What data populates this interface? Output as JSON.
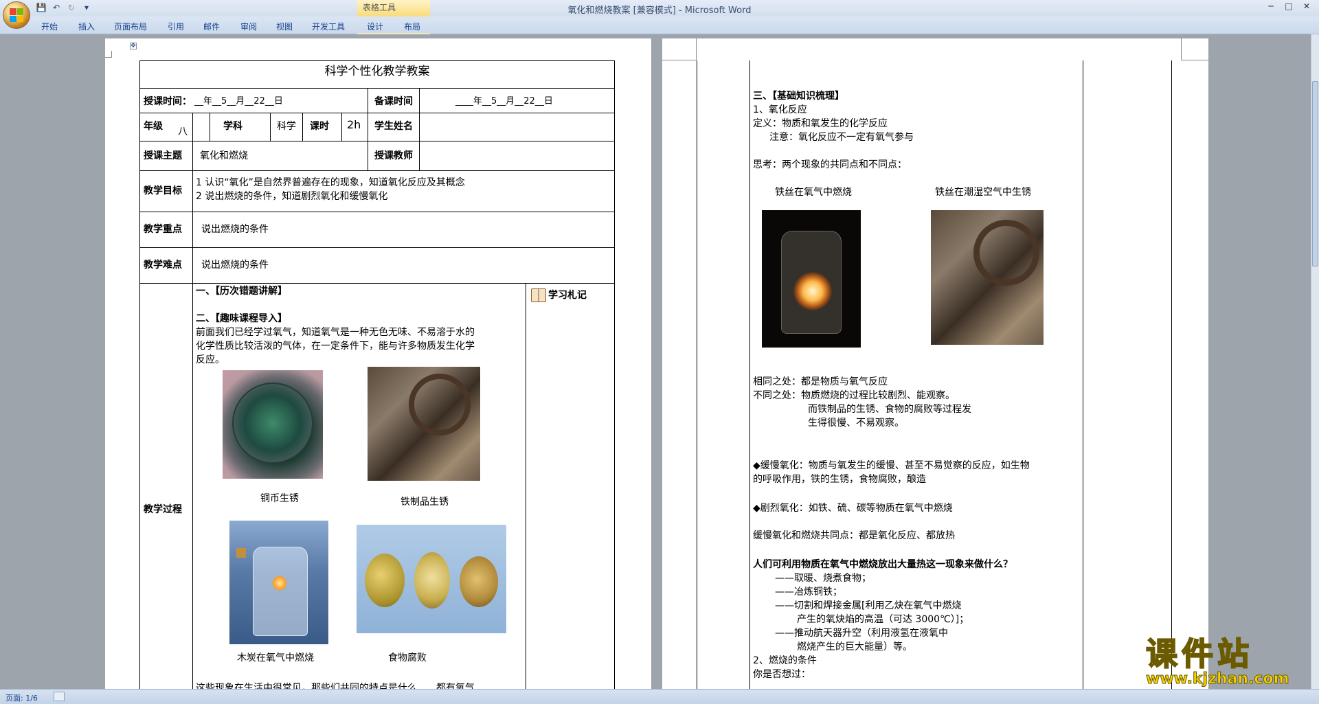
{
  "window": {
    "title": "氧化和燃烧教案 [兼容模式] - Microsoft Word",
    "context_tab": "表格工具"
  },
  "ribbon_tabs": [
    "开始",
    "插入",
    "页面布局",
    "引用",
    "邮件",
    "审阅",
    "视图",
    "开发工具",
    "设计",
    "布局"
  ],
  "status": {
    "page": "页面: 1/6"
  },
  "page1": {
    "title": "科学个性化教学教案",
    "row_time": {
      "label": "授课时间：",
      "value": "__年__5__月__22__日",
      "prep_label": "备课时间",
      "prep_value": "____年__5__月__22__日"
    },
    "row_grade": {
      "grade_label": "年级",
      "grade_value": "八",
      "subject_label": "学科",
      "subject_value": "科学",
      "hours_label": "课时",
      "hours_value": "2h",
      "student_label": "学生姓名"
    },
    "row_topic": {
      "label": "授课主题",
      "value": "氧化和燃烧",
      "teacher_label": "授课教师"
    },
    "row_goal": {
      "label": "教学目标",
      "lines": [
        "1 认识“氧化”是自然界普遍存在的现象，知道氧化反应及其概念",
        "2 说出燃烧的条件，知道剧烈氧化和缓慢氧化"
      ]
    },
    "row_key": {
      "label": "教学重点",
      "value": "说出燃烧的条件"
    },
    "row_diff": {
      "label": "教学难点",
      "value": "说出燃烧的条件"
    },
    "row_process": {
      "label": "教学过程",
      "notes_label": "学习札记",
      "h1": "一、【历次错题讲解】",
      "h2": "二、【趣味课程导入】",
      "intro": [
        "前面我们已经学过氧气，知道氧气是一种无色无味、不易溶于水的",
        "化学性质比较活泼的气体，在一定条件下，能与许多物质发生化学",
        "反应。"
      ],
      "captions": [
        "铜币生锈",
        "铁制品生锈",
        "木炭在氧气中燃烧",
        "食物腐败"
      ],
      "bottom_line": "这些现象在生活中很常见，那些们共同的特点是什么……都有氧气"
    }
  },
  "page2": {
    "h3": "三、【基础知识梳理】",
    "sec1": "1、氧化反应",
    "def": "定义：物质和氧发生的化学反应",
    "note": "注意：氧化反应不一定有氧气参与",
    "think": "思考：两个现象的共同点和不同点：",
    "captions": [
      "铁丝在氧气中燃烧",
      "铁丝在潮湿空气中生锈"
    ],
    "same": "相同之处：都是物质与氧气反应",
    "diff": [
      "不同之处：物质燃烧的过程比较剧烈、能观察。",
      "而铁制品的生锈、食物的腐败等过程发",
      "生得很慢、不易观察。"
    ],
    "slow": [
      "◆缓慢氧化：物质与氧发生的缓慢、甚至不易觉察的反应，如生物",
      "的呼吸作用，铁的生锈，食物腐败，酿造"
    ],
    "fast": "◆剧烈氧化：如铁、硫、碳等物质在氧气中燃烧",
    "common": "缓慢氧化和燃烧共同点：都是氧化反应、都放热",
    "question": "人们可利用物质在氧气中燃烧放出大量热这一现象来做什么？",
    "uses": [
      "——取暖、烧煮食物；",
      "——冶炼铜铁；",
      "——切割和焊接金属[利用乙炔在氧气中燃烧",
      "产生的氧炔焰的高温（可达 3000℃）]；",
      "——推动航天器升空（利用液氢在液氧中",
      "燃烧产生的巨大能量）等。"
    ],
    "sec2": "2、燃烧的条件",
    "ask": "你是否想过："
  },
  "watermark": {
    "text": "课件站",
    "url": "www.kjzhan.com"
  }
}
